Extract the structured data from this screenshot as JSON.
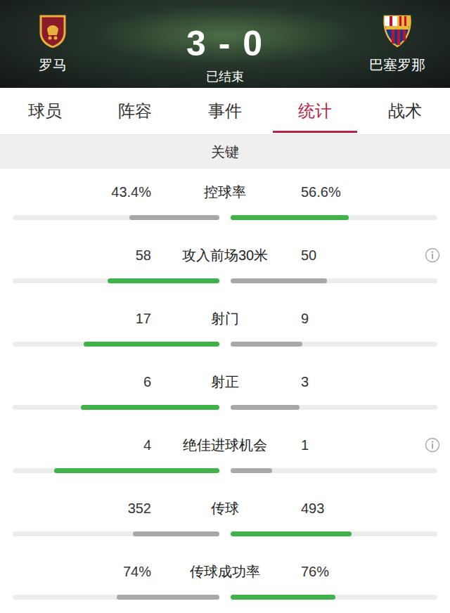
{
  "header": {
    "home": {
      "name": "罗马"
    },
    "away": {
      "name": "巴塞罗那"
    },
    "score": "3 - 0",
    "status": "已结束"
  },
  "tabs": [
    {
      "label": "球员",
      "selected": false
    },
    {
      "label": "阵容",
      "selected": false
    },
    {
      "label": "事件",
      "selected": false
    },
    {
      "label": "统计",
      "selected": true
    },
    {
      "label": "战术",
      "selected": false
    }
  ],
  "section": {
    "title": "关键"
  },
  "stats": [
    {
      "label": "控球率",
      "info": false,
      "home": {
        "value": "43.4%",
        "level": 0.435,
        "leading": false
      },
      "away": {
        "value": "56.6%",
        "level": 0.57,
        "leading": true
      }
    },
    {
      "label": "攻入前场30米",
      "info": true,
      "home": {
        "value": "58",
        "level": 0.54,
        "leading": true
      },
      "away": {
        "value": "50",
        "level": 0.466,
        "leading": false
      }
    },
    {
      "label": "射门",
      "info": false,
      "home": {
        "value": "17",
        "level": 0.656,
        "leading": true
      },
      "away": {
        "value": "9",
        "level": 0.347,
        "leading": false
      }
    },
    {
      "label": "射正",
      "info": false,
      "home": {
        "value": "6",
        "level": 0.67,
        "leading": true
      },
      "away": {
        "value": "3",
        "level": 0.333,
        "leading": false
      }
    },
    {
      "label": "绝佳进球机会",
      "info": true,
      "home": {
        "value": "4",
        "level": 0.8,
        "leading": true
      },
      "away": {
        "value": "1",
        "level": 0.2,
        "leading": false
      }
    },
    {
      "label": "传球",
      "info": false,
      "home": {
        "value": "352",
        "level": 0.418,
        "leading": false
      },
      "away": {
        "value": "493",
        "level": 0.585,
        "leading": true
      }
    },
    {
      "label": "传球成功率",
      "info": false,
      "home": {
        "value": "74%",
        "level": 0.497,
        "leading": false
      },
      "away": {
        "value": "76%",
        "level": 0.507,
        "leading": true
      }
    }
  ]
}
